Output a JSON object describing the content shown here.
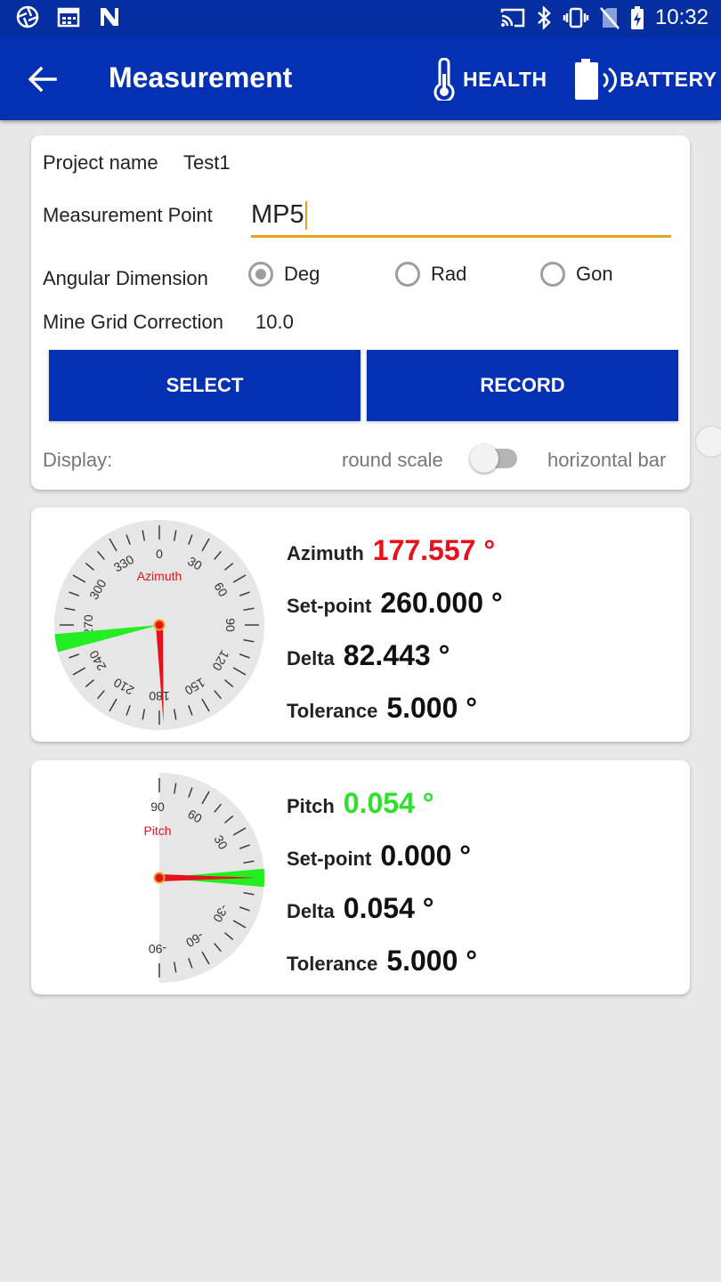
{
  "status_bar": {
    "time": "10:32"
  },
  "app_bar": {
    "title": "Measurement",
    "health_label": "HEALTH",
    "battery_label": "BATTERY"
  },
  "form": {
    "project_label": "Project name",
    "project_value": "Test1",
    "mp_label": "Measurement Point",
    "mp_value": "MP5",
    "angular_label": "Angular Dimension",
    "angular_options": [
      "Deg",
      "Rad",
      "Gon"
    ],
    "angular_selected": "Deg",
    "mgc_label": "Mine Grid Correction",
    "mgc_value": "10.0",
    "select_label": "SELECT",
    "record_label": "RECORD",
    "display_label": "Display:",
    "display_left": "round scale",
    "display_right": "horizontal bar",
    "display_toggle_on": false
  },
  "azimuth": {
    "gauge_title": "Azimuth",
    "azimuth_label": "Azimuth",
    "azimuth_value": "177.557 °",
    "setpoint_label": "Set-point",
    "setpoint_value": "260.000 °",
    "delta_label": "Delta",
    "delta_value": "82.443 °",
    "tolerance_label": "Tolerance",
    "tolerance_value": "5.000 °",
    "needle_deg": 177.557,
    "setpoint_deg": 260,
    "tolerance_deg": 5,
    "tick_labels": [
      "0",
      "30",
      "60",
      "90",
      "120",
      "150",
      "180",
      "210",
      "240",
      "270",
      "300",
      "330"
    ]
  },
  "pitch": {
    "gauge_title": "Pitch",
    "pitch_label": "Pitch",
    "pitch_value": "0.054 °",
    "setpoint_label": "Set-point",
    "setpoint_value": "0.000 °",
    "delta_label": "Delta",
    "delta_value": "0.054 °",
    "tolerance_label": "Tolerance",
    "tolerance_value": "5.000 °",
    "needle_deg": 0.054,
    "setpoint_deg": 0,
    "tolerance_deg": 5,
    "tick_labels": [
      "90",
      "60",
      "30",
      "-30",
      "-60",
      "-90"
    ]
  },
  "colors": {
    "primary": "#0430b4",
    "status_bar": "#052ea0",
    "accent": "#e8a21a",
    "value_red": "#e8101a",
    "value_green": "#2ee02c",
    "tolerance_wedge": "#22ee22"
  }
}
